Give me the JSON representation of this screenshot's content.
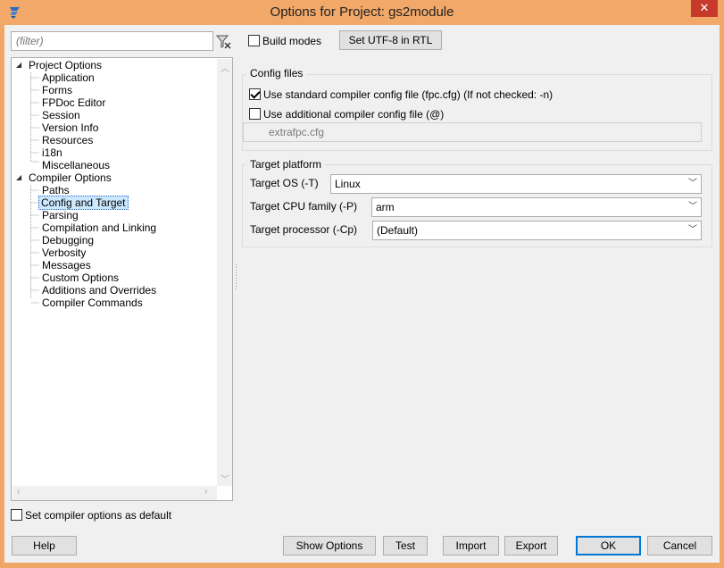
{
  "window": {
    "title": "Options for Project: gs2module",
    "close_glyph": "✕"
  },
  "filter": {
    "placeholder": "(filter)"
  },
  "tree": {
    "project_options": {
      "label": "Project Options",
      "children": [
        "Application",
        "Forms",
        "FPDoc Editor",
        "Session",
        "Version Info",
        "Resources",
        "i18n",
        "Miscellaneous"
      ]
    },
    "compiler_options": {
      "label": "Compiler Options",
      "children": [
        "Paths",
        "Config and Target",
        "Parsing",
        "Compilation and Linking",
        "Debugging",
        "Verbosity",
        "Messages",
        "Custom Options",
        "Additions and Overrides",
        "Compiler Commands"
      ],
      "selected": "Config and Target"
    }
  },
  "set_default_label": "Set compiler options as default",
  "toolbar": {
    "build_modes_label": "Build modes",
    "utf8_button": "Set UTF-8 in RTL"
  },
  "config_files": {
    "title": "Config files",
    "standard_label": "Use standard compiler config file (fpc.cfg) (If not checked: -n)",
    "standard_checked": true,
    "additional_label": "Use additional compiler config file (@)",
    "additional_checked": false,
    "additional_value": "extrafpc.cfg"
  },
  "target_platform": {
    "title": "Target platform",
    "os_label": "Target OS (-T)",
    "os_value": "Linux",
    "cpu_label": "Target CPU family (-P)",
    "cpu_value": "arm",
    "processor_label": "Target processor (-Cp)",
    "processor_value": "(Default)"
  },
  "buttons": {
    "help": "Help",
    "show_options": "Show Options",
    "test": "Test",
    "import": "Import",
    "export": "Export",
    "ok": "OK",
    "cancel": "Cancel"
  },
  "colors": {
    "title_bar": "#f2a868",
    "close_button": "#c7392b",
    "selection": "#cce8ff"
  }
}
